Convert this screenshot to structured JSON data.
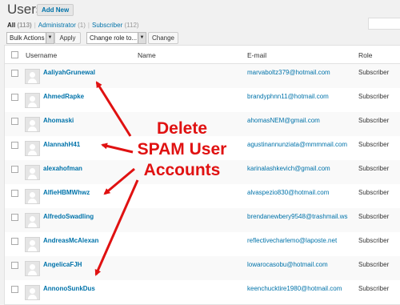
{
  "header": {
    "title": "Users",
    "add_new": "Add New"
  },
  "filters": [
    {
      "label": "All",
      "count": "(113)",
      "current": true
    },
    {
      "label": "Administrator",
      "count": "(1)",
      "current": false
    },
    {
      "label": "Subscriber",
      "count": "(112)",
      "current": false
    }
  ],
  "bulk": {
    "bulk_actions": "Bulk Actions",
    "apply": "Apply",
    "change_role": "Change role to...",
    "change": "Change"
  },
  "columns": {
    "username": "Username",
    "name": "Name",
    "email": "E-mail",
    "role": "Role"
  },
  "users": [
    {
      "username": "AaliyahGrunewal",
      "name": "",
      "email": "marvaboltz379@hotmail.com",
      "role": "Subscriber"
    },
    {
      "username": "AhmedRapke",
      "name": "",
      "email": "brandyphnn11@hotmail.com",
      "role": "Subscriber"
    },
    {
      "username": "Ahomaski",
      "name": "",
      "email": "ahomasNEM@gmail.com",
      "role": "Subscriber"
    },
    {
      "username": "AlannahH41",
      "name": "",
      "email": "agustinannunziata@mmmmail.com",
      "role": "Subscriber"
    },
    {
      "username": "alexahofman",
      "name": "",
      "email": "karinalashkevich@gmail.com",
      "role": "Subscriber"
    },
    {
      "username": "AlfieHBMWhwz",
      "name": "",
      "email": "alvaspezio830@hotmail.com",
      "role": "Subscriber"
    },
    {
      "username": "AlfredoSwadling",
      "name": "",
      "email": "brendanewbery9548@trashmail.ws",
      "role": "Subscriber"
    },
    {
      "username": "AndreasMcAlexan",
      "name": "",
      "email": "reflectivecharlemo@laposte.net",
      "role": "Subscriber"
    },
    {
      "username": "AngelicaFJH",
      "name": "",
      "email": "lowarocasobu@hotmail.com",
      "role": "Subscriber"
    },
    {
      "username": "AnnonoSunkDus",
      "name": "",
      "email": "keenchucktire1980@hotmail.com",
      "role": "Subscriber"
    }
  ],
  "annotation": {
    "line1": "Delete",
    "line2": "SPAM User",
    "line3": "Accounts",
    "color": "#e01111"
  },
  "icons": {
    "checkbox": "checkbox-icon",
    "avatar": "avatar-icon",
    "select_arrow": "triangle-down-icon"
  }
}
